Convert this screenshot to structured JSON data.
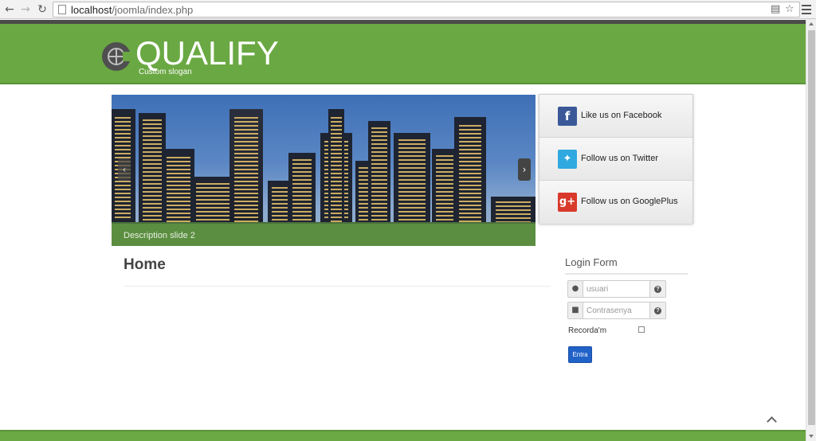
{
  "browser": {
    "back_icon": "back-arrow-icon",
    "forward_icon": "forward-arrow-icon",
    "reload_icon": "reload-icon",
    "url_host": "localhost",
    "url_path": "/joomla/index.php"
  },
  "site": {
    "logo_text": "QUALIFY",
    "slogan": "Custom slogan",
    "accent_color": "#6aa843"
  },
  "slider": {
    "caption": "Description slide 2",
    "prev_icon": "chevron-left-icon",
    "next_icon": "chevron-right-icon"
  },
  "social": {
    "items": [
      {
        "label": "Like us on Facebook",
        "icon": "facebook-icon",
        "color": "#3b5998"
      },
      {
        "label": "Follow us on Twitter",
        "icon": "twitter-icon",
        "color": "#2fa9e0"
      },
      {
        "label": "Follow us on GooglePlus",
        "icon": "googleplus-icon",
        "color": "#d8392b"
      }
    ]
  },
  "main": {
    "title": "Home"
  },
  "login": {
    "title": "Login Form",
    "username_placeholder": "usuari",
    "password_placeholder": "Contrasenya",
    "remember_label": "Recorda'm",
    "submit_label": "Entra"
  }
}
